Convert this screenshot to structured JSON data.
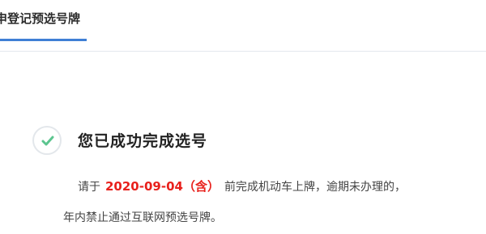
{
  "tab": {
    "label": "申登记预选号牌"
  },
  "success": {
    "title": "您已成功完成选号",
    "desc_prefix": "请于",
    "deadline": "2020-09-04（含）",
    "desc_suffix": "前完成机动车上牌，逾期未办理的，",
    "desc_line2": "年内禁止通过互联网预选号牌。"
  },
  "colors": {
    "accent": "#3f7fd5",
    "success_green": "#5cc58f",
    "deadline_red": "#e8211c"
  }
}
